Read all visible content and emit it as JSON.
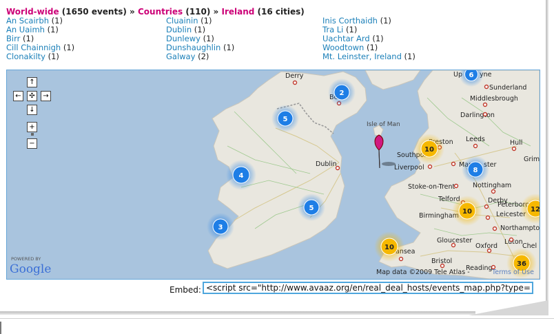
{
  "breadcrumb": {
    "worldwide": "World-wide",
    "worldwide_count": " (1650 events) ",
    "sep1": "»",
    "countries": "Countries",
    "countries_count": " (110) ",
    "sep2": "»",
    "ireland": "Ireland",
    "ireland_count": " (16 cities)"
  },
  "cities": {
    "col1": [
      {
        "name": "An Scairbh",
        "count": " (1)"
      },
      {
        "name": "An Uaimh",
        "count": " (1)"
      },
      {
        "name": "Birr",
        "count": " (1)"
      },
      {
        "name": "Cill Chainnigh",
        "count": " (1)"
      },
      {
        "name": "Clonakilty",
        "count": " (1)"
      }
    ],
    "col2": [
      {
        "name": "Cluainin",
        "count": " (1)"
      },
      {
        "name": "Dublin",
        "count": " (1)"
      },
      {
        "name": "Dunlewy",
        "count": " (1)"
      },
      {
        "name": "Dunshaughlin",
        "count": " (1)"
      },
      {
        "name": "Galway",
        "count": " (2)"
      }
    ],
    "col3": [
      {
        "name": "Inis Corthaidh",
        "count": " (1)"
      },
      {
        "name": "Tra Li",
        "count": " (1)"
      },
      {
        "name": "Uachtar Ard",
        "count": " (1)"
      },
      {
        "name": "Woodtown",
        "count": " (1)"
      },
      {
        "name": "Mt. Leinster, Ireland",
        "count": " (1)"
      }
    ]
  },
  "map": {
    "place_labels": {
      "derry": "Derry",
      "belfast": "Be",
      "uptyne": "Up",
      "uptyne2": "yne",
      "sunderland": "Sunderland",
      "middlesbrough": "Middlesbrough",
      "darlington": "Darlington",
      "isle_of_man": "Isle of Man",
      "dublin": "Dublin",
      "preston": "Preston",
      "leeds": "Leeds",
      "hull": "Hull",
      "grim": "Grim",
      "southport": "Southport",
      "liverpool": "Liverpool",
      "manchester": "Mar",
      "manchester2": "ster",
      "stoke": "Stoke-on-Trent",
      "nottingham": "Nottingham",
      "derby": "Derby",
      "telford": "Telford",
      "peterborough": "Peterborou",
      "birmingham": "Birmingham",
      "leicester": "Leicester",
      "northampton": "Northampton",
      "gloucester": "Gloucester",
      "oxford": "Oxford",
      "luton": "Luton",
      "chel": "Chel",
      "swansea": "ansea",
      "bristol": "Bristol",
      "reading": "Reading"
    },
    "clusters": [
      {
        "label": "6",
        "color": "#1e7ee6"
      },
      {
        "label": "2",
        "color": "#1e7ee6"
      },
      {
        "label": "5",
        "color": "#1e7ee6"
      },
      {
        "label": "4",
        "color": "#1e7ee6"
      },
      {
        "label": "5",
        "color": "#1e7ee6"
      },
      {
        "label": "3",
        "color": "#1e7ee6"
      },
      {
        "label": "8",
        "color": "#1e7ee6"
      },
      {
        "label": "10",
        "color": "#f6b800"
      },
      {
        "label": "10",
        "color": "#f6b800"
      },
      {
        "label": "12",
        "color": "#f6b800"
      },
      {
        "label": "10",
        "color": "#f6b800"
      },
      {
        "label": "36",
        "color": "#f6b800"
      }
    ],
    "controls": {
      "up": "↑",
      "left": "←",
      "center": "✣",
      "right": "→",
      "down": "↓",
      "zoom_in": "+",
      "zoom_out": "−"
    },
    "powered_by": "POWERED BY",
    "google": "Google",
    "attribution": "Map data ©2009 Tele Atlas -",
    "terms": "Terms of Use"
  },
  "embed": {
    "label": "Embed:",
    "value": "<script src=\"http://www.avaaz.org/en/real_deal_hosts/events_map.php?type=js\"></"
  },
  "colors": {
    "link_pink": "#cc0077",
    "link_blue": "#1a7fb8",
    "sea": "#a9c4de",
    "land": "#e9e7df",
    "border": "#66a6d8"
  }
}
